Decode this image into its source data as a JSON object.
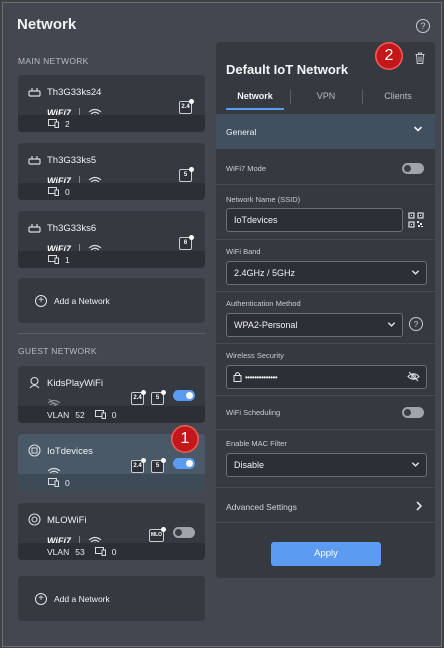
{
  "app": {
    "title": "Network"
  },
  "sections": {
    "main": "MAIN NETWORK",
    "guest": "GUEST NETWORK"
  },
  "main_networks": [
    {
      "name": "Th3G33ks24",
      "wifi": "WiFi7",
      "band": "2.4",
      "devices": "2"
    },
    {
      "name": "Th3G33ks5",
      "wifi": "WiFi7",
      "band": "5",
      "devices": "0"
    },
    {
      "name": "Th3G33ks6",
      "wifi": "WiFi7",
      "band": "6",
      "devices": "1"
    }
  ],
  "add_network_label": "Add a Network",
  "guest_networks": [
    {
      "name": "KidsPlayWiFi",
      "bands": [
        "2.4",
        "5"
      ],
      "vlan_label": "VLAN",
      "vlan": "52",
      "devices": "0",
      "enabled": true
    },
    {
      "name": "IoTdevices",
      "bands": [
        "2.4",
        "5"
      ],
      "devices": "0",
      "enabled": true,
      "selected": true
    },
    {
      "name": "MLOWiFi",
      "wifi": "WiFi7",
      "band": "MLO",
      "vlan_label": "VLAN",
      "vlan": "53",
      "devices": "0",
      "enabled": false
    }
  ],
  "badges": {
    "one": "1",
    "two": "2"
  },
  "panel": {
    "title": "Default IoT Network",
    "tabs": [
      "Network",
      "VPN",
      "Clients"
    ],
    "section": "General",
    "wifi7_mode_label": "WiFi7 Mode",
    "ssid_label": "Network Name (SSID)",
    "ssid_value": "IoTdevices",
    "band_label": "WiFi Band",
    "band_value": "2.4GHz / 5GHz",
    "auth_label": "Authentication Method",
    "auth_value": "WPA2-Personal",
    "security_label": "Wireless Security",
    "security_value": "••••••••••••••",
    "scheduling_label": "WiFi Scheduling",
    "mac_label": "Enable MAC Filter",
    "mac_value": "Disable",
    "advanced_label": "Advanced Settings",
    "apply_label": "Apply"
  },
  "colors": {
    "accent": "#5b9cf2",
    "badge": "#c4171a",
    "selected_card": "#4a5968"
  },
  "icons": [
    "help-icon",
    "wifi-icon",
    "devices-icon",
    "trash-icon",
    "chevron-down-icon",
    "chevron-right-icon",
    "lock-icon",
    "eye-off-icon",
    "qr-code-icon",
    "plus-circle-icon",
    "kids-icon",
    "iot-icon",
    "mlo-icon"
  ]
}
